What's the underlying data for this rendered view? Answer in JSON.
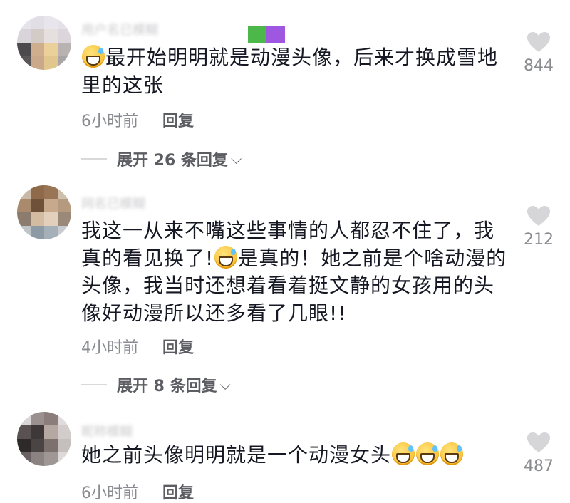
{
  "comments": [
    {
      "username": "用户名已模糊",
      "text_before": "",
      "text_after": "最开始明明就是动漫头像，后来才换成雪地里的这张",
      "time": "6小时前",
      "reply_label": "回复",
      "expand": "展开 26 条回复",
      "likes": "844"
    },
    {
      "username": "网名已模糊",
      "text_before": "我这一从来不嘴这些事情的人都忍不住了，我真的看见换了!",
      "text_after": "是真的！她之前是个啥动漫的头像，我当时还想着看着挺文静的女孩用的头像好动漫所以还多看了几眼!!",
      "time": "4小时前",
      "reply_label": "回复",
      "expand": "展开 8 条回复",
      "likes": "212"
    },
    {
      "username": "昵称模糊",
      "text_before": "她之前头像明明就是一个动漫女头",
      "text_after": "",
      "time": "6小时前",
      "reply_label": "回复",
      "likes": "487"
    }
  ],
  "icons": {
    "like": "heart-icon",
    "emoji": "grin-sweat-emoji",
    "expand": "chevron-down-icon"
  },
  "colors": {
    "text": "#161823",
    "meta": "#8a8b91",
    "heart": "#d6d6d9"
  }
}
